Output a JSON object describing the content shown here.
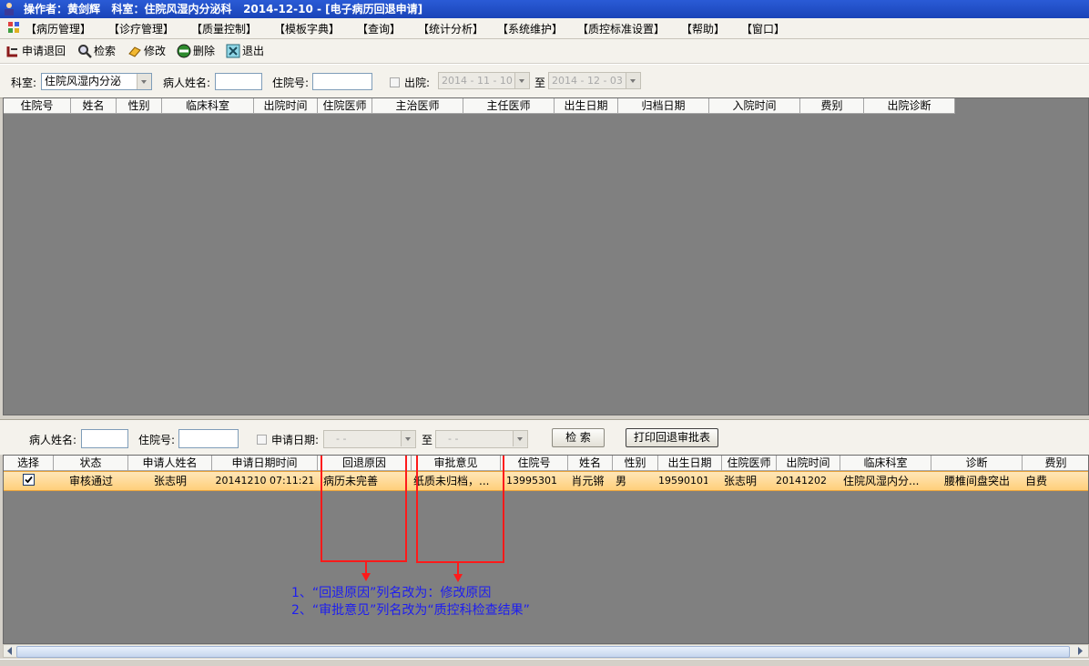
{
  "window": {
    "title": "操作者：黄剑辉   科室：住院风湿内分泌科   2014-12-10 - [电子病历回退申请]"
  },
  "menu": [
    "【病历管理】",
    "【诊疗管理】",
    "【质量控制】",
    "【模板字典】",
    "【查询】",
    "【统计分析】",
    "【系统维护】",
    "【质控标准设置】",
    "【帮助】",
    "【窗口】"
  ],
  "toolbar": {
    "apply": "申请退回",
    "search": "检索",
    "edit": "修改",
    "delete": "删除",
    "exit": "退出"
  },
  "filter_top": {
    "dept_label": "科室:",
    "dept_value": "住院风湿内分泌",
    "patient_label": "病人姓名:",
    "patient_value": "",
    "admission_label": "住院号:",
    "admission_value": "",
    "discharge_label": "出院:",
    "date_from": "2014 - 11 - 10",
    "to_label": "至",
    "date_to": "2014 - 12 - 03"
  },
  "grid_top": {
    "columns": [
      "住院号",
      "姓名",
      "性别",
      "临床科室",
      "出院时间",
      "住院医师",
      "主治医师",
      "主任医师",
      "出生日期",
      "归档日期",
      "入院时间",
      "费别",
      "出院诊断"
    ]
  },
  "filter_bottom": {
    "patient_label": "病人姓名:",
    "patient_value": "",
    "admission_label": "住院号:",
    "admission_value": "",
    "apply_date_label": "申请日期:",
    "date_from": "-  -",
    "to_label": "至",
    "date_to": "-  -",
    "search_button": "检 索",
    "print_button": "打印回退审批表"
  },
  "grid_bottom": {
    "columns": [
      "选择",
      "状态",
      "申请人姓名",
      "申请日期时间",
      "回退原因",
      "审批意见",
      "住院号",
      "姓名",
      "性别",
      "出生日期",
      "住院医师",
      "出院时间",
      "临床科室",
      "诊断",
      "费别"
    ],
    "rows": [
      [
        "",
        "审核通过",
        "张志明",
        "20141210 07:11:21",
        "病历未完善",
        "纸质未归档，...",
        "13995301",
        "肖元锵",
        "男",
        "19590101",
        "张志明",
        "20141202",
        "住院风湿内分...",
        "腰椎间盘突出",
        "自费"
      ]
    ]
  },
  "annotations": {
    "line1": "1、“回退原因”列名改为：修改原因",
    "line2": "2、“审批意见”列名改为“质控科检查结果”"
  },
  "colors": {
    "highlight_box": "#ff1a1a",
    "note_text": "#1d1df0",
    "selected_row": "#ffcf7a"
  }
}
